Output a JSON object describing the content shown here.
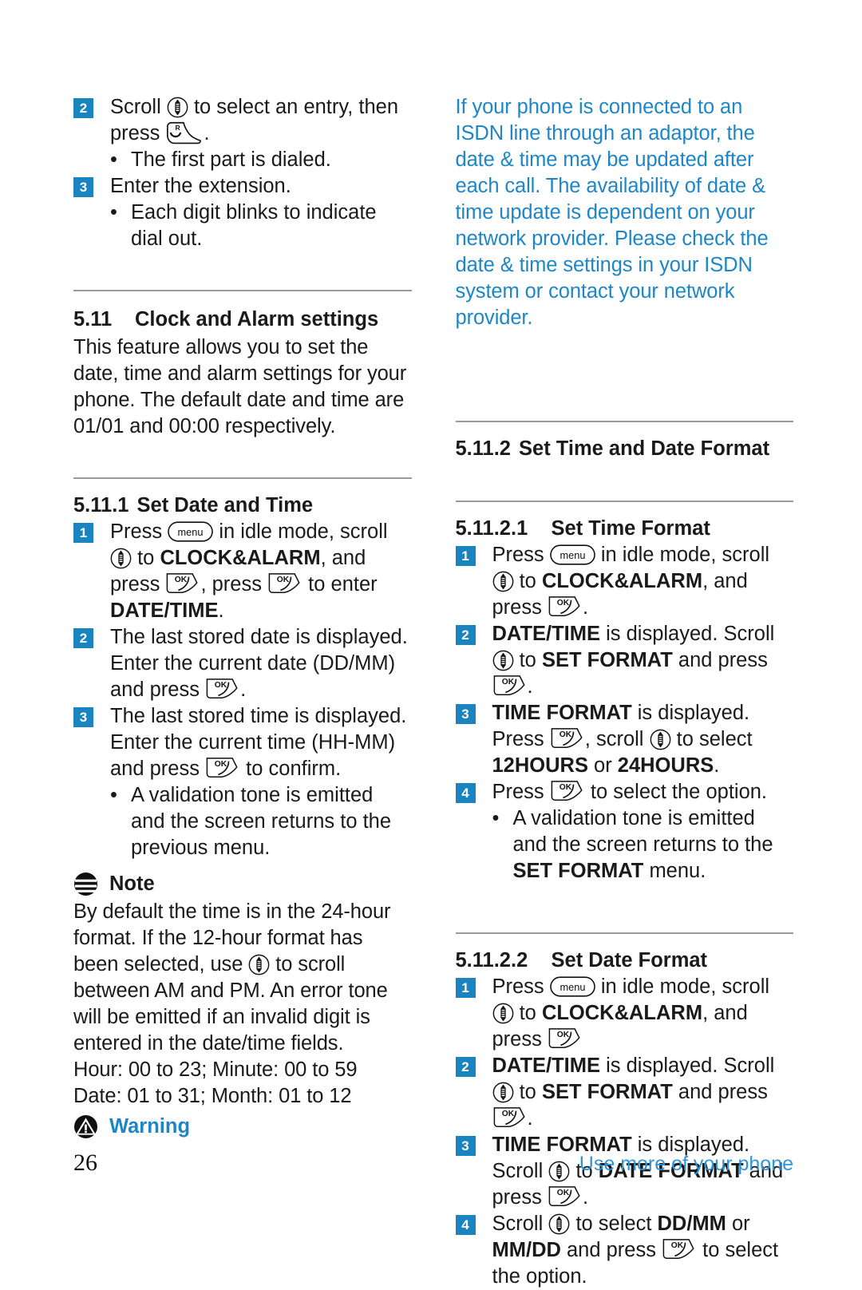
{
  "page": {
    "number": "26",
    "footer_text": "Use more of your phone",
    "accent_blue": "#1a84c0",
    "note_blue": "#1e86c7",
    "rule_gray": "#9a9a9a"
  },
  "icons": {
    "scroll": "scroll-updown-icon",
    "menu": "menu-key-icon",
    "ok": "ok-softkey-icon",
    "talk": "talk-key-icon",
    "note": "note-icon",
    "warning": "warning-icon"
  },
  "left_column": {
    "steps_top": [
      {
        "num": "2",
        "parts": [
          {
            "t": "text",
            "v": "Scroll "
          },
          {
            "t": "icon",
            "v": "scroll"
          },
          {
            "t": "text",
            "v": " to select an entry, then press "
          },
          {
            "t": "icon",
            "v": "talk"
          },
          {
            "t": "text",
            "v": "."
          }
        ]
      }
    ],
    "bullet_first_part": "The first part is dialed.",
    "step3_label": "3",
    "step3_text": "Enter the extension.",
    "bullet_each_digit": "Each digit blinks to indicate dial out.",
    "section_511": {
      "number": "5.11",
      "title": "Clock and Alarm settings",
      "body": "This feature allows you to set the date, time and alarm settings for your phone. The default date and time are 01/01 and 00:00 respectively."
    },
    "section_5111": {
      "number": "5.11.1",
      "title": "Set Date and Time",
      "steps": [
        {
          "num": "1",
          "segments": [
            {
              "t": "text",
              "v": "Press "
            },
            {
              "t": "icon",
              "v": "menu"
            },
            {
              "t": "text",
              "v": " in idle mode, scroll "
            },
            {
              "t": "icon",
              "v": "scroll"
            },
            {
              "t": "text",
              "v": " to "
            },
            {
              "t": "bold",
              "v": "CLOCK&ALARM"
            },
            {
              "t": "text",
              "v": ", and press "
            },
            {
              "t": "icon",
              "v": "ok"
            },
            {
              "t": "text",
              "v": ", press "
            },
            {
              "t": "icon",
              "v": "ok"
            },
            {
              "t": "text",
              "v": " to enter "
            },
            {
              "t": "bold",
              "v": "DATE/TIME"
            },
            {
              "t": "text",
              "v": "."
            }
          ]
        },
        {
          "num": "2",
          "segments": [
            {
              "t": "text",
              "v": "The last stored date is displayed. Enter the current date (DD/MM) and press "
            },
            {
              "t": "icon",
              "v": "ok"
            },
            {
              "t": "text",
              "v": "."
            }
          ]
        },
        {
          "num": "3",
          "segments": [
            {
              "t": "text",
              "v": "The last stored time is displayed. Enter the current time (HH-MM) and press "
            },
            {
              "t": "icon",
              "v": "ok"
            },
            {
              "t": "text",
              "v": " to confirm."
            }
          ]
        }
      ],
      "bullet_validation": "A validation tone is emitted and the screen returns to the previous menu."
    },
    "note": {
      "title": "Note",
      "text_part1": "By default the time is in the 24-hour format. If the 12-hour format has been selected, use ",
      "text_part2": " to scroll between AM and PM. An error tone will be emitted if an invalid digit is entered in the date/time fields.",
      "range_hour": "Hour: 00 to 23; Minute: 00 to 59",
      "range_date": "Date: 01 to 31; Month: 01 to 12"
    },
    "warning": {
      "title": "Warning"
    }
  },
  "right_column": {
    "isdn_note": "If your phone is connected to an ISDN line through an adaptor, the date & time may be updated after each call. The availability of date & time update is dependent on your network provider. Please check the date & time settings in your ISDN system or contact your network provider.",
    "section_5112": {
      "number": "5.11.2",
      "title": "Set Time and Date Format"
    },
    "section_51121": {
      "number": "5.11.2.1",
      "title": "Set Time Format",
      "steps": [
        {
          "num": "1",
          "segments": [
            {
              "t": "text",
              "v": "Press "
            },
            {
              "t": "icon",
              "v": "menu"
            },
            {
              "t": "text",
              "v": " in idle mode, scroll "
            },
            {
              "t": "icon",
              "v": "scroll"
            },
            {
              "t": "text",
              "v": " to "
            },
            {
              "t": "bold",
              "v": "CLOCK&ALARM"
            },
            {
              "t": "text",
              "v": ", and press "
            },
            {
              "t": "icon",
              "v": "ok"
            },
            {
              "t": "text",
              "v": "."
            }
          ]
        },
        {
          "num": "2",
          "segments": [
            {
              "t": "bold",
              "v": "DATE/TIME"
            },
            {
              "t": "text",
              "v": " is displayed. Scroll "
            },
            {
              "t": "icon",
              "v": "scroll"
            },
            {
              "t": "text",
              "v": " to "
            },
            {
              "t": "bold",
              "v": "SET FORMAT"
            },
            {
              "t": "text",
              "v": " and press "
            },
            {
              "t": "icon",
              "v": "ok"
            },
            {
              "t": "text",
              "v": "."
            }
          ]
        },
        {
          "num": "3",
          "segments": [
            {
              "t": "bold",
              "v": "TIME FORMAT"
            },
            {
              "t": "text",
              "v": " is displayed. Press "
            },
            {
              "t": "icon",
              "v": "ok"
            },
            {
              "t": "text",
              "v": ", scroll "
            },
            {
              "t": "icon",
              "v": "scroll"
            },
            {
              "t": "text",
              "v": " to select "
            },
            {
              "t": "bold",
              "v": "12HOURS"
            },
            {
              "t": "text",
              "v": " or "
            },
            {
              "t": "bold",
              "v": "24HOURS"
            },
            {
              "t": "text",
              "v": "."
            }
          ]
        },
        {
          "num": "4",
          "segments": [
            {
              "t": "text",
              "v": "Press "
            },
            {
              "t": "icon",
              "v": "ok"
            },
            {
              "t": "text",
              "v": " to select the option."
            }
          ]
        }
      ],
      "bullet_validation_segments": [
        {
          "t": "text",
          "v": "A validation tone is emitted and the screen returns to the "
        },
        {
          "t": "bold",
          "v": "SET FORMAT"
        },
        {
          "t": "text",
          "v": " menu."
        }
      ]
    },
    "section_51122": {
      "number": "5.11.2.2",
      "title": "Set Date Format",
      "steps": [
        {
          "num": "1",
          "segments": [
            {
              "t": "text",
              "v": "Press "
            },
            {
              "t": "icon",
              "v": "menu"
            },
            {
              "t": "text",
              "v": " in idle mode, scroll "
            },
            {
              "t": "icon",
              "v": "scroll"
            },
            {
              "t": "text",
              "v": " to "
            },
            {
              "t": "bold",
              "v": "CLOCK&ALARM"
            },
            {
              "t": "text",
              "v": ", and press "
            },
            {
              "t": "icon",
              "v": "ok"
            }
          ]
        },
        {
          "num": "2",
          "segments": [
            {
              "t": "bold",
              "v": "DATE/TIME"
            },
            {
              "t": "text",
              "v": " is displayed. Scroll "
            },
            {
              "t": "icon",
              "v": "scroll"
            },
            {
              "t": "text",
              "v": " to "
            },
            {
              "t": "bold",
              "v": "SET FORMAT"
            },
            {
              "t": "text",
              "v": " and press "
            },
            {
              "t": "icon",
              "v": "ok"
            },
            {
              "t": "text",
              "v": "."
            }
          ]
        },
        {
          "num": "3",
          "segments": [
            {
              "t": "bold",
              "v": "TIME FORMAT"
            },
            {
              "t": "text",
              "v": " is displayed. Scroll "
            },
            {
              "t": "icon",
              "v": "scroll"
            },
            {
              "t": "text",
              "v": " to "
            },
            {
              "t": "bold",
              "v": "DATE FORMAT"
            },
            {
              "t": "text",
              "v": " and press "
            },
            {
              "t": "icon",
              "v": "ok"
            },
            {
              "t": "text",
              "v": "."
            }
          ]
        },
        {
          "num": "4",
          "segments": [
            {
              "t": "text",
              "v": "Scroll "
            },
            {
              "t": "icon",
              "v": "scroll"
            },
            {
              "t": "text",
              "v": " to select "
            },
            {
              "t": "bold",
              "v": "DD/MM"
            },
            {
              "t": "text",
              "v": " or "
            },
            {
              "t": "bold",
              "v": "MM/DD"
            },
            {
              "t": "text",
              "v": " and press "
            },
            {
              "t": "icon",
              "v": "ok"
            },
            {
              "t": "text",
              "v": " to select the option."
            }
          ]
        }
      ]
    }
  }
}
